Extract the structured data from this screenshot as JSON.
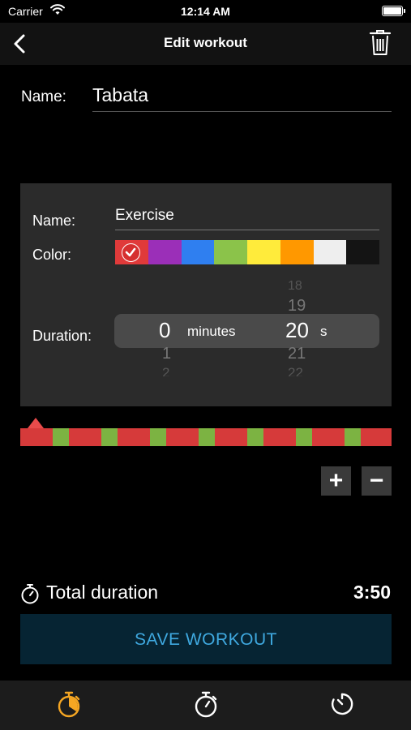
{
  "status_bar": {
    "carrier": "Carrier",
    "time": "12:14 AM"
  },
  "nav": {
    "title": "Edit workout",
    "back_icon": "chevron-left-icon",
    "delete_icon": "trash-icon"
  },
  "workout": {
    "name_label": "Name:",
    "name_value": "Tabata"
  },
  "segment": {
    "name_label": "Name:",
    "name_value": "Exercise",
    "color_label": "Color:",
    "colors": [
      "#e03a3a",
      "#9b2fb8",
      "#2f7ff0",
      "#8bc34a",
      "#ffeb3b",
      "#ff9800",
      "#eeeeee",
      "#141414"
    ],
    "selected_color_index": 0,
    "duration_label": "Duration:",
    "picker": {
      "minutes_value": "0",
      "minutes_unit": "minutes",
      "seconds_value": "20",
      "seconds_unit": "s",
      "minutes_below": [
        "1",
        "2"
      ],
      "seconds_above": [
        "18",
        "19"
      ],
      "seconds_below": [
        "21",
        "22"
      ]
    }
  },
  "timeline_colors": {
    "work": "#d63a3a",
    "rest": "#7cb342"
  },
  "buttons": {
    "add_label": "+",
    "remove_label": "−"
  },
  "total": {
    "label": "Total duration",
    "value": "3:50"
  },
  "save": {
    "label": "SAVE WORKOUT"
  },
  "tabs": [
    {
      "icon": "stopwatch-icon",
      "active": true,
      "color": "#f5a623"
    },
    {
      "icon": "stopwatch-icon",
      "active": false,
      "color": "#ffffff"
    },
    {
      "icon": "timer-icon",
      "active": false,
      "color": "#ffffff"
    }
  ]
}
